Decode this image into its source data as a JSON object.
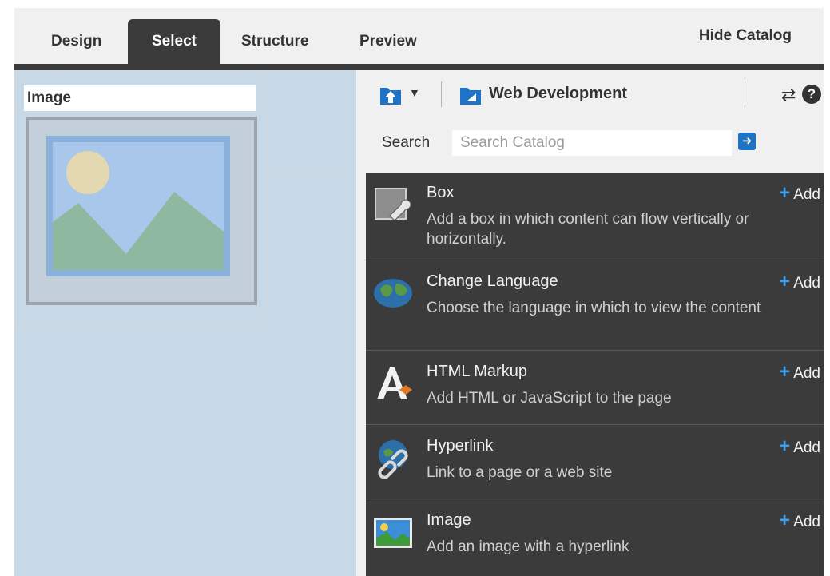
{
  "tabs": {
    "design": "Design",
    "select": "Select",
    "structure": "Structure",
    "preview": "Preview",
    "hide_catalog": "Hide Catalog"
  },
  "canvas": {
    "image_label": "Image"
  },
  "toolbar": {
    "folder_label": "Web Development"
  },
  "search": {
    "label": "Search",
    "placeholder": "Search Catalog",
    "value": ""
  },
  "catalog_items": [
    {
      "name": "Box",
      "description": "Add a box in which content can flow vertically or horizontally.",
      "add_label": "Add",
      "icon": "box-wrench-icon"
    },
    {
      "name": "Change Language",
      "description": "Choose the language in which to view the content",
      "add_label": "Add",
      "icon": "globe-icon"
    },
    {
      "name": "HTML Markup",
      "description": "Add HTML or JavaScript to the page",
      "add_label": "Add",
      "icon": "html-markup-icon"
    },
    {
      "name": "Hyperlink",
      "description": "Link to a page or a web site",
      "add_label": "Add",
      "icon": "hyperlink-icon"
    },
    {
      "name": "Image",
      "description": "Add an image with a hyperlink",
      "add_label": "Add",
      "icon": "image-icon"
    }
  ],
  "colors": {
    "active_tab": "#3b3b3b",
    "canvas_bg": "#c7d9e7",
    "catalog_list_bg": "#3b3b3b",
    "accent_blue": "#1f73c6",
    "add_plus": "#3ea0ee"
  }
}
